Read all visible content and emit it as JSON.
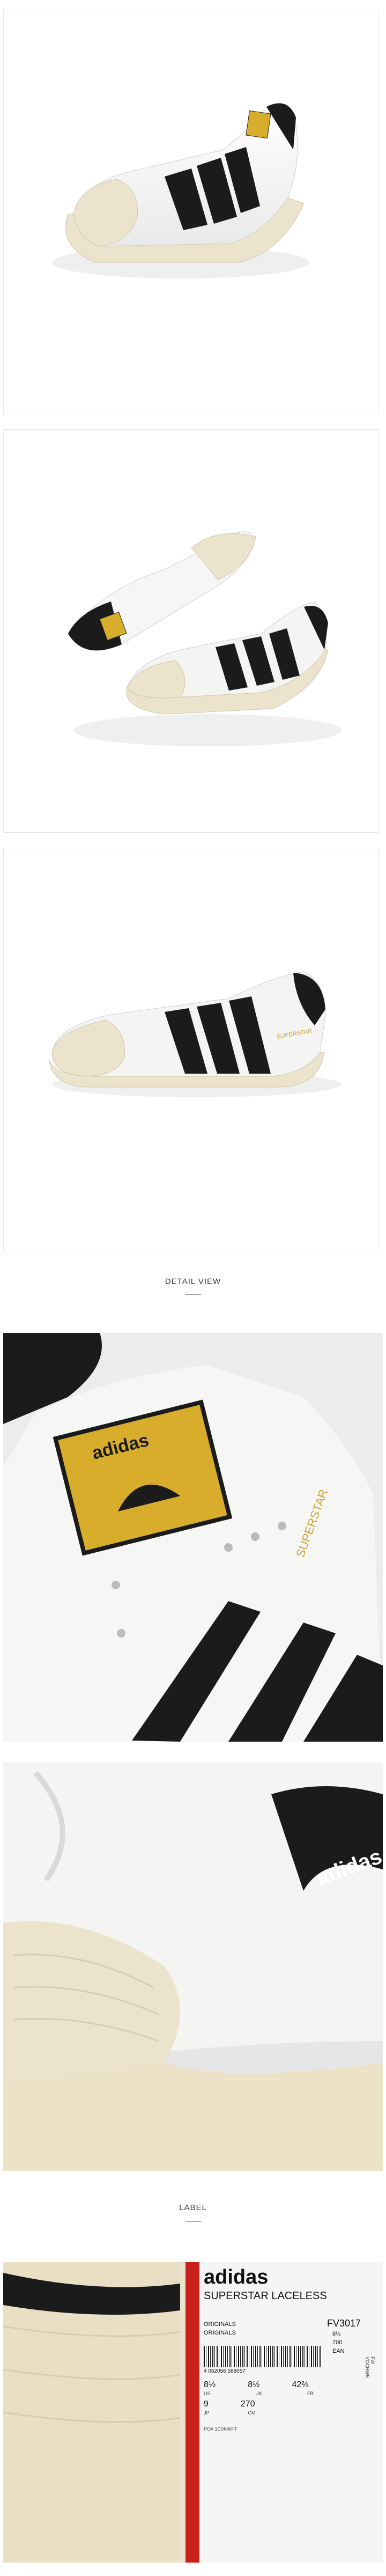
{
  "sections": {
    "detail_view": "DETAIL VIEW",
    "label": "LABEL"
  },
  "product": {
    "brand_tongue_text": "SUPERSTAR",
    "side_print": "SUPERSTAR"
  },
  "tag": {
    "brand": "adidas",
    "model": "SUPERSTAR LACELESS",
    "line1": "ORIGINALS",
    "line2": "ORIGINALS",
    "code": "FV3017",
    "size_top": "8½",
    "size_700": "700",
    "ean_label": "EAN",
    "sizes": [
      "8½",
      "8½",
      "42⅔"
    ],
    "size_units": [
      "US",
      "UK",
      "FR"
    ],
    "sizes_b": [
      "9",
      "270"
    ],
    "size_units_b": [
      "JP",
      "CM"
    ],
    "barcode_number": "4 062056 588057",
    "side_code": "FW VOCHW5",
    "origin_note": "PO# 1C0KWFT"
  },
  "colors": {
    "leather": "#f4f4f2",
    "stripe": "#1b1b1b",
    "toe_cap": "#ece3cc",
    "gold": "#d8ad2c"
  }
}
